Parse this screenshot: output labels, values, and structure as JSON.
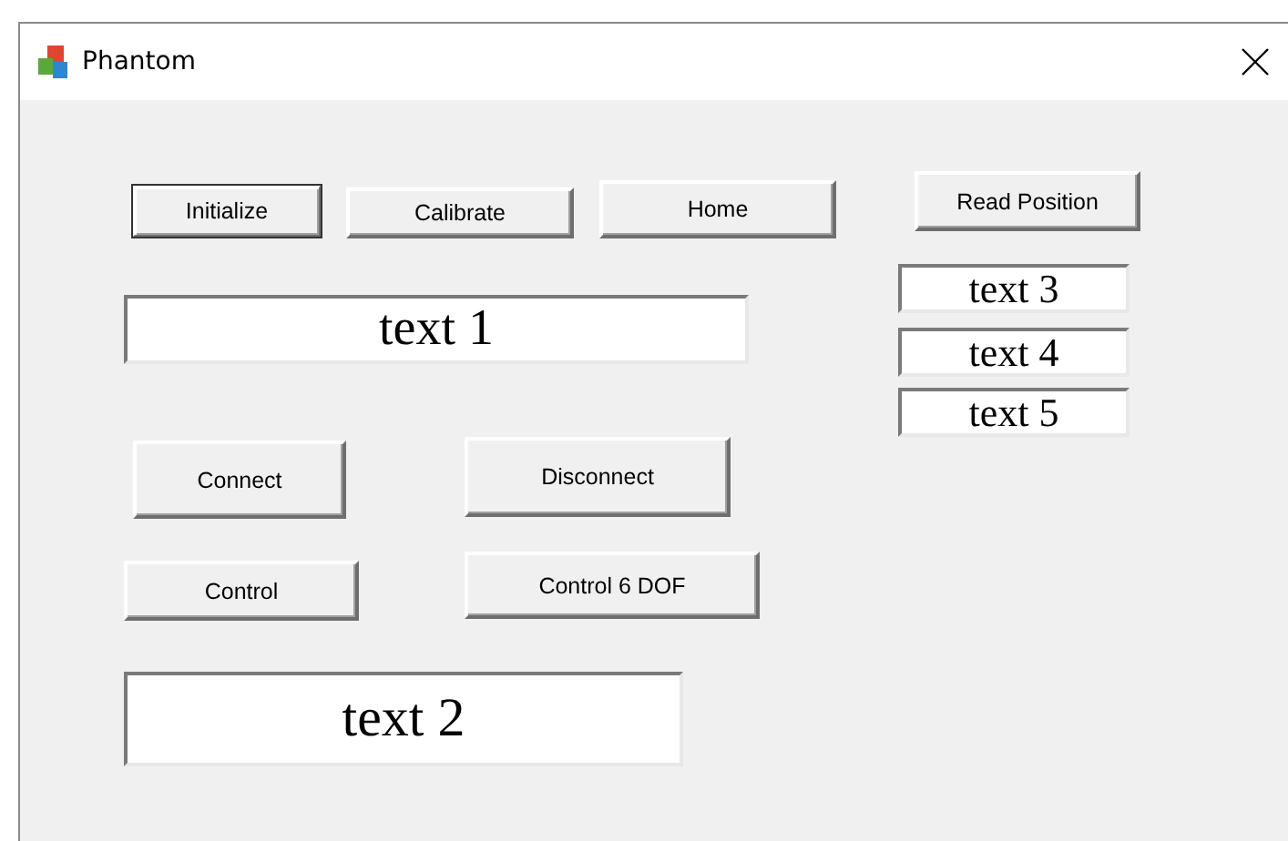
{
  "window": {
    "title": "Phantom"
  },
  "buttons": [
    {
      "label": "Initialize",
      "default": true
    },
    {
      "label": "Calibrate",
      "default": false
    },
    {
      "label": "Home",
      "default": false
    },
    {
      "label": "Connect",
      "default": false
    },
    {
      "label": "Disconnect",
      "default": false
    },
    {
      "label": "Control",
      "default": false
    },
    {
      "label": "Control 6 DOF",
      "default": false
    },
    {
      "label": "Read Position",
      "default": false
    }
  ],
  "fields": [
    {
      "value": "text 1"
    },
    {
      "value": "text 2"
    },
    {
      "value": "text 3"
    },
    {
      "value": "text 4"
    },
    {
      "value": "text 5"
    }
  ]
}
